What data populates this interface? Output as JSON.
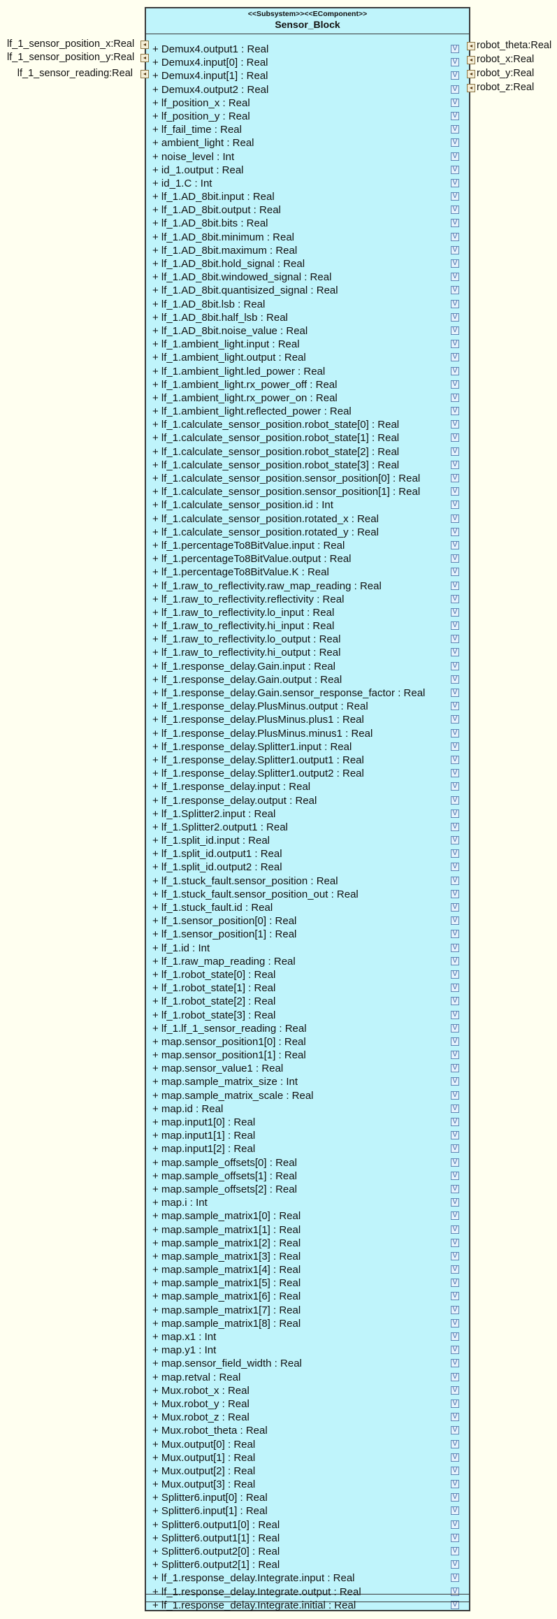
{
  "block": {
    "stereotype": "<<Subsystem>><<EComponent>>",
    "name": "Sensor_Block"
  },
  "ports_left": [
    {
      "label": "lf_1_sensor_position_x:Real"
    },
    {
      "label": "lf_1_sensor_position_y:Real"
    },
    {
      "label": "lf_1_sensor_reading:Real"
    }
  ],
  "ports_right": [
    {
      "label": "robot_theta:Real"
    },
    {
      "label": "robot_x:Real"
    },
    {
      "label": "robot_y:Real"
    },
    {
      "label": "robot_z:Real"
    }
  ],
  "checkbox_glyph": "V",
  "attributes": [
    "+ Demux4.output1 : Real",
    "+ Demux4.input[0] : Real",
    "+ Demux4.input[1] : Real",
    "+ Demux4.output2 : Real",
    "+ lf_position_x : Real",
    "+ lf_position_y : Real",
    "+ lf_fail_time : Real",
    "+ ambient_light : Real",
    "+ noise_level : Int",
    "+ id_1.output : Real",
    "+ id_1.C : Int",
    "+ lf_1.AD_8bit.input : Real",
    "+ lf_1.AD_8bit.output : Real",
    "+ lf_1.AD_8bit.bits : Real",
    "+ lf_1.AD_8bit.minimum : Real",
    "+ lf_1.AD_8bit.maximum : Real",
    "+ lf_1.AD_8bit.hold_signal : Real",
    "+ lf_1.AD_8bit.windowed_signal : Real",
    "+ lf_1.AD_8bit.quantisized_signal : Real",
    "+ lf_1.AD_8bit.lsb : Real",
    "+ lf_1.AD_8bit.half_lsb : Real",
    "+ lf_1.AD_8bit.noise_value : Real",
    "+ lf_1.ambient_light.input : Real",
    "+ lf_1.ambient_light.output : Real",
    "+ lf_1.ambient_light.led_power : Real",
    "+ lf_1.ambient_light.rx_power_off : Real",
    "+ lf_1.ambient_light.rx_power_on : Real",
    "+ lf_1.ambient_light.reflected_power : Real",
    "+ lf_1.calculate_sensor_position.robot_state[0] : Real",
    "+ lf_1.calculate_sensor_position.robot_state[1] : Real",
    "+ lf_1.calculate_sensor_position.robot_state[2] : Real",
    "+ lf_1.calculate_sensor_position.robot_state[3] : Real",
    "+ lf_1.calculate_sensor_position.sensor_position[0] : Real",
    "+ lf_1.calculate_sensor_position.sensor_position[1] : Real",
    "+ lf_1.calculate_sensor_position.id : Int",
    "+ lf_1.calculate_sensor_position.rotated_x : Real",
    "+ lf_1.calculate_sensor_position.rotated_y : Real",
    "+ lf_1.percentageTo8BitValue.input : Real",
    "+ lf_1.percentageTo8BitValue.output : Real",
    "+ lf_1.percentageTo8BitValue.K : Real",
    "+ lf_1.raw_to_reflectivity.raw_map_reading : Real",
    "+ lf_1.raw_to_reflectivity.reflectivity : Real",
    "+ lf_1.raw_to_reflectivity.lo_input : Real",
    "+ lf_1.raw_to_reflectivity.hi_input : Real",
    "+ lf_1.raw_to_reflectivity.lo_output : Real",
    "+ lf_1.raw_to_reflectivity.hi_output : Real",
    "+ lf_1.response_delay.Gain.input : Real",
    "+ lf_1.response_delay.Gain.output : Real",
    "+ lf_1.response_delay.Gain.sensor_response_factor : Real",
    "+ lf_1.response_delay.PlusMinus.output : Real",
    "+ lf_1.response_delay.PlusMinus.plus1 : Real",
    "+ lf_1.response_delay.PlusMinus.minus1 : Real",
    "+ lf_1.response_delay.Splitter1.input : Real",
    "+ lf_1.response_delay.Splitter1.output1 : Real",
    "+ lf_1.response_delay.Splitter1.output2 : Real",
    "+ lf_1.response_delay.input : Real",
    "+ lf_1.response_delay.output : Real",
    "+ lf_1.Splitter2.input : Real",
    "+ lf_1.Splitter2.output1 : Real",
    "+ lf_1.split_id.input : Real",
    "+ lf_1.split_id.output1 : Real",
    "+ lf_1.split_id.output2 : Real",
    "+ lf_1.stuck_fault.sensor_position : Real",
    "+ lf_1.stuck_fault.sensor_position_out : Real",
    "+ lf_1.stuck_fault.id : Real",
    "+ lf_1.sensor_position[0] : Real",
    "+ lf_1.sensor_position[1] : Real",
    "+ lf_1.id : Int",
    "+ lf_1.raw_map_reading : Real",
    "+ lf_1.robot_state[0] : Real",
    "+ lf_1.robot_state[1] : Real",
    "+ lf_1.robot_state[2] : Real",
    "+ lf_1.robot_state[3] : Real",
    "+ lf_1.lf_1_sensor_reading : Real",
    "+ map.sensor_position1[0] : Real",
    "+ map.sensor_position1[1] : Real",
    "+ map.sensor_value1 : Real",
    "+ map.sample_matrix_size : Int",
    "+ map.sample_matrix_scale : Real",
    "+ map.id : Real",
    "+ map.input1[0] : Real",
    "+ map.input1[1] : Real",
    "+ map.input1[2] : Real",
    "+ map.sample_offsets[0] : Real",
    "+ map.sample_offsets[1] : Real",
    "+ map.sample_offsets[2] : Real",
    "+ map.i : Int",
    "+ map.sample_matrix1[0] : Real",
    "+ map.sample_matrix1[1] : Real",
    "+ map.sample_matrix1[2] : Real",
    "+ map.sample_matrix1[3] : Real",
    "+ map.sample_matrix1[4] : Real",
    "+ map.sample_matrix1[5] : Real",
    "+ map.sample_matrix1[6] : Real",
    "+ map.sample_matrix1[7] : Real",
    "+ map.sample_matrix1[8] : Real",
    "+ map.x1 : Int",
    "+ map.y1 : Int",
    "+ map.sensor_field_width : Real",
    "+ map.retval : Real",
    "+ Mux.robot_x : Real",
    "+ Mux.robot_y : Real",
    "+ Mux.robot_z : Real",
    "+ Mux.robot_theta : Real",
    "+ Mux.output[0] : Real",
    "+ Mux.output[1] : Real",
    "+ Mux.output[2] : Real",
    "+ Mux.output[3] : Real",
    "+ Splitter6.input[0] : Real",
    "+ Splitter6.input[1] : Real",
    "+ Splitter6.output1[0] : Real",
    "+ Splitter6.output1[1] : Real",
    "+ Splitter6.output2[0] : Real",
    "+ Splitter6.output2[1] : Real",
    "+ lf_1.response_delay.Integrate.input : Real",
    "+ lf_1.response_delay.Integrate.output : Real",
    "+ lf_1.response_delay.Integrate.initial : Real"
  ]
}
